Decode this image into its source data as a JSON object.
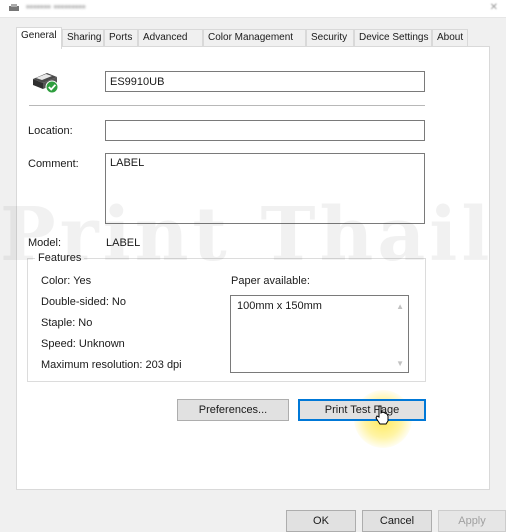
{
  "tabs": [
    {
      "label": "General",
      "active": true
    },
    {
      "label": "Sharing"
    },
    {
      "label": "Ports"
    },
    {
      "label": "Advanced"
    },
    {
      "label": "Color Management"
    },
    {
      "label": "Security"
    },
    {
      "label": "Device Settings"
    },
    {
      "label": "About"
    }
  ],
  "printer": {
    "name": "ES9910UB",
    "icon": "printer-default-check-icon"
  },
  "location": {
    "label": "Location:",
    "value": ""
  },
  "comment": {
    "label": "Comment:",
    "value": "LABEL"
  },
  "model": {
    "label": "Model:",
    "value": "LABEL"
  },
  "features": {
    "legend": "Features",
    "color": "Color: Yes",
    "double_sided": "Double-sided: No",
    "staple": "Staple: No",
    "speed": "Speed: Unknown",
    "max_resolution": "Maximum resolution: 203 dpi",
    "paper_label": "Paper available:",
    "paper_sizes": [
      "100mm x 150mm"
    ]
  },
  "buttons": {
    "preferences": "Preferences...",
    "print_test_page": "Print Test Page",
    "ok": "OK",
    "cancel": "Cancel",
    "apply": "Apply"
  },
  "watermark": "Print Thail",
  "colors": {
    "accent": "#0078d7",
    "check_green": "#2e9e3e",
    "highlight": "#ffe63c"
  }
}
